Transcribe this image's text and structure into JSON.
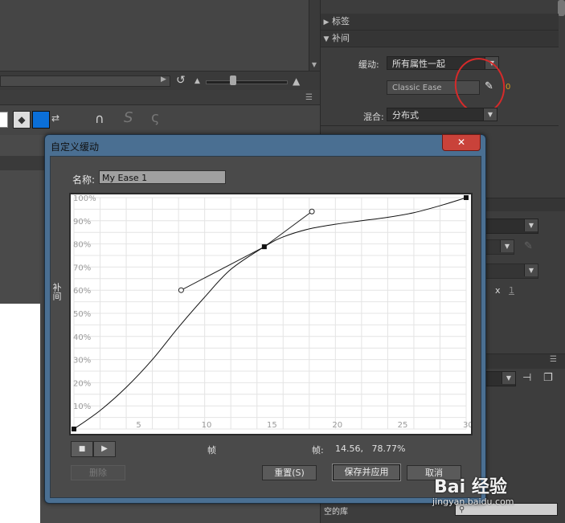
{
  "right_panel": {
    "sections": {
      "label_section": "标签",
      "tween_section": "补间"
    },
    "ease": {
      "label": "缓动:",
      "value": "所有属性一起",
      "classic_ease": "Classic Ease",
      "marker": "0"
    },
    "blend": {
      "label": "混合:",
      "value": "分布式"
    },
    "x_label": "x",
    "x_value": "1",
    "library_empty": "空的库"
  },
  "dialog": {
    "title": "自定义缓动",
    "close": "✕",
    "name_label": "名称:",
    "name_value": "My Ease 1",
    "y_axis_title": "补间",
    "x_axis_title": "帧",
    "readout_label": "帧:",
    "readout_value": "14.56,   78.77%",
    "stop_label": "■",
    "play_label": "▶",
    "buttons": {
      "delete": "删除",
      "reset": "重置(S)",
      "save_apply": "保存并应用",
      "cancel": "取消"
    }
  },
  "chart_data": {
    "type": "line",
    "title": "",
    "xlabel": "帧",
    "ylabel": "补间",
    "xlim": [
      0,
      30
    ],
    "ylim": [
      0,
      100
    ],
    "x_ticks": [
      "5",
      "10",
      "15",
      "20",
      "25",
      "30"
    ],
    "y_ticks": [
      "10%",
      "20%",
      "30%",
      "40%",
      "50%",
      "60%",
      "70%",
      "80%",
      "90%",
      "100%"
    ],
    "grid": true,
    "series": [
      {
        "x": [
          0,
          2,
          4,
          6,
          8,
          10,
          12,
          14.56,
          16,
          18,
          20,
          22,
          24,
          26,
          28,
          30
        ],
        "values": [
          0,
          8,
          18,
          30,
          44,
          57,
          69,
          78.77,
          83,
          86.5,
          88.5,
          90,
          91.5,
          93.5,
          96.5,
          100
        ]
      }
    ],
    "keyframes": [
      {
        "x": 0,
        "y": 0
      },
      {
        "x": 14.56,
        "y": 78.77
      },
      {
        "x": 30,
        "y": 100
      }
    ],
    "tangent_handles": [
      {
        "x": 8.2,
        "y": 60
      },
      {
        "x": 18.2,
        "y": 94
      }
    ]
  },
  "watermark": {
    "brand": "Bai 经验",
    "url": "jingyan.baidu.com"
  }
}
